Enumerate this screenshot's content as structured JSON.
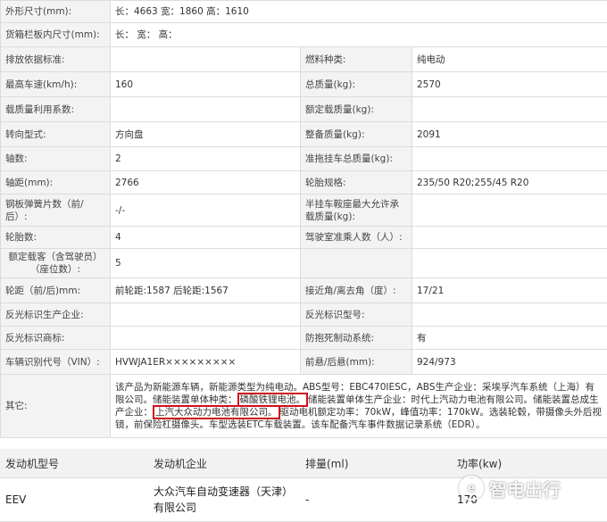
{
  "spec_rows": [
    {
      "type": "wide",
      "label": "外形尺寸(mm):",
      "value": "长：4663 宽：1860 高：1610"
    },
    {
      "type": "wide",
      "label": "货箱栏板内尺寸(mm):",
      "value": "长：  宽：  高："
    },
    {
      "type": "pair",
      "label1": "排放依据标准:",
      "value1": "",
      "label2": "燃料种类:",
      "value2": "纯电动"
    },
    {
      "type": "pair",
      "label1": "最高车速(km/h):",
      "value1": "160",
      "label2": "总质量(kg):",
      "value2": "2570"
    },
    {
      "type": "pair",
      "label1": "载质量利用系数:",
      "value1": "",
      "label2": "额定载质量(kg):",
      "value2": ""
    },
    {
      "type": "pair",
      "label1": "转向型式:",
      "value1": "方向盘",
      "label2": "整备质量(kg):",
      "value2": "2091"
    },
    {
      "type": "pair",
      "label1": "轴数:",
      "value1": "2",
      "label2": "准拖挂车总质量(kg):",
      "value2": ""
    },
    {
      "type": "pair",
      "label1": "轴距(mm):",
      "value1": "2766",
      "label2": "轮胎规格:",
      "value2": "235/50 R20;255/45 R20"
    },
    {
      "type": "pair",
      "label1": "钢板弹簧片数（前/后）:",
      "value1": "-/-",
      "label2": "半挂车鞍座最大允许承载质量(kg):",
      "value2": ""
    },
    {
      "type": "pair",
      "label1": "轮胎数:",
      "value1": "4",
      "label2": "驾驶室准乘人数（人）:",
      "value2": ""
    },
    {
      "type": "pair",
      "label1": "额定载客（含驾驶员）（座位数）:",
      "value1": "5",
      "label2": "",
      "value2": ""
    },
    {
      "type": "pair",
      "label1": "轮距（前/后)mm:",
      "value1": "前轮距:1587 后轮距:1567",
      "label2": "接近角/离去角（度）:",
      "value2": "17/21"
    },
    {
      "type": "pair",
      "label1": "反光标识生产企业:",
      "value1": "",
      "label2": "反光标识型号:",
      "value2": ""
    },
    {
      "type": "pair",
      "label1": "反光标识商标:",
      "value1": "",
      "label2": "防抱死制动系统:",
      "value2": "有"
    },
    {
      "type": "pair",
      "label1": "车辆识别代号（VIN）:",
      "value1": "HVWJA1ER×××××××××",
      "label2": "前悬/后悬(mm):",
      "value2": "924/973"
    }
  ],
  "other": {
    "label": "其它:",
    "t1": "该产品为新能源车辆，新能源类型为纯电动。ABS型号：EBC470IESC，ABS生产企业：采埃孚汽车系统（上海）有限公司。储能装置单体种类：",
    "h1": "磷酸铁锂电池。",
    "t2": "储能装置单体生产企业：时代上汽动力电池有限公司。储能装置总成生产企业：",
    "h2": "上汽大众动力电池有限公司。",
    "t3": "驱动电机额定功率：70kW，峰值功率：170kW。选装轮毂，带摄像头外后视镜，前保险杠摄像头。车型选装ETC车载装置。该车配备汽车事件数据记录系统（EDR）。"
  },
  "engine": {
    "headers": [
      "发动机型号",
      "发动机企业",
      "排量(ml)",
      "功率(kw)"
    ],
    "rows": [
      {
        "model": "EEV",
        "company": "大众汽车自动变速器（天津）有限公司",
        "displacement": "-",
        "power": "170"
      }
    ]
  },
  "watermark": {
    "logo": "e",
    "text": "智电出行"
  }
}
